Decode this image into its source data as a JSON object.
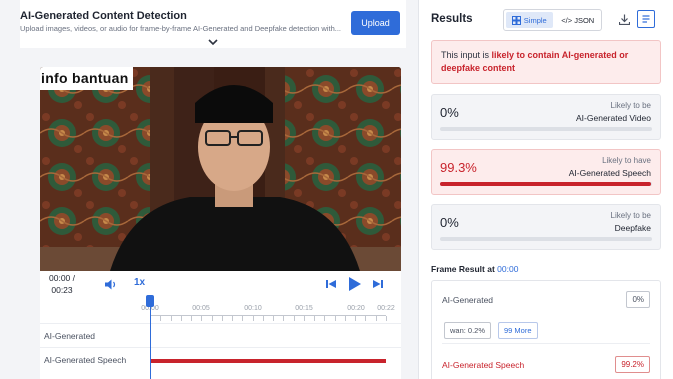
{
  "header": {
    "title": "AI-Generated Content Detection",
    "subtitle": "Upload images, videos, or audio for frame-by-frame AI-Generated and Deepfake detection with...",
    "upload_label": "Upload"
  },
  "video": {
    "overlay_text": "info bantuan",
    "time_current": "00:00 /",
    "time_total": "00:23",
    "speed": "1x"
  },
  "timeline": {
    "ticks": [
      "00:00",
      "00:05",
      "00:10",
      "00:15",
      "00:20",
      "00:22"
    ],
    "rows": [
      {
        "label": "AI-Generated",
        "flagged": false
      },
      {
        "label": "AI-Generated Speech",
        "flagged": true
      }
    ]
  },
  "results": {
    "title": "Results",
    "toggle_simple": "Simple",
    "toggle_json": "</> JSON",
    "warning_prefix": "This input is ",
    "warning_highlight": "likely to contain AI-generated or deepfake content",
    "cards": [
      {
        "pct": "0%",
        "line1": "Likely to be",
        "line2": "AI-Generated Video",
        "fill": 0,
        "highlight": false
      },
      {
        "pct": "99.3%",
        "line1": "Likely to have",
        "line2": "AI-Generated Speech",
        "fill": 0.993,
        "highlight": true
      },
      {
        "pct": "0%",
        "line1": "Likely to be",
        "line2": "Deepfake",
        "fill": 0,
        "highlight": false
      }
    ],
    "frame_result_label": "Frame Result at",
    "frame_result_time": "00:00",
    "frame": {
      "ai_generated_label": "AI-Generated",
      "ai_generated_pct": "0%",
      "chip_wan": "wan: 0.2%",
      "chip_more": "99 More",
      "speech_label": "AI-Generated Speech",
      "speech_pct": "99.2%"
    }
  },
  "colors": {
    "accent": "#2f6cd9",
    "danger": "#c8232c",
    "danger_bg": "#fdecec"
  }
}
